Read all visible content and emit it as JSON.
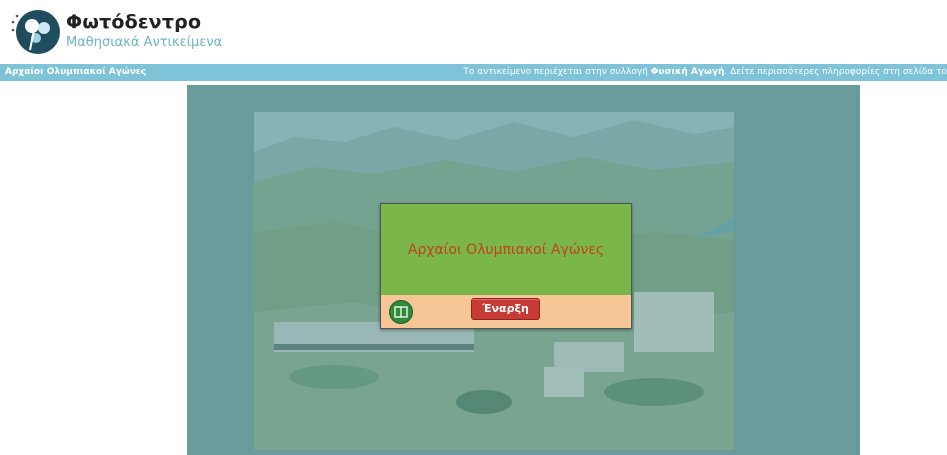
{
  "header": {
    "logo_title": "Φωτόδεντρο",
    "logo_subtitle": "Μαθησιακά Αντικείμενα"
  },
  "infobar": {
    "object_title": "Αρχαίοι Ολυμπιακοί Αγώνες",
    "collection_prefix": "Το αντικείμενο περιέχεται στην συλλογή ",
    "collection_name": "Φυσική Αγωγή",
    "collection_suffix": ". Δείτε περισσότερες πληροφορίες στη σελίδα το"
  },
  "dialog": {
    "title": "Αρχαίοι Ολυμπιακοί Αγώνες",
    "start_label": "Έναρξη"
  },
  "colors": {
    "infobar": "#7ec3d8",
    "dialog_green": "#7bb64a",
    "dialog_peach": "#f7c697",
    "start_red": "#c63b35",
    "title_orange": "#c0441d"
  }
}
